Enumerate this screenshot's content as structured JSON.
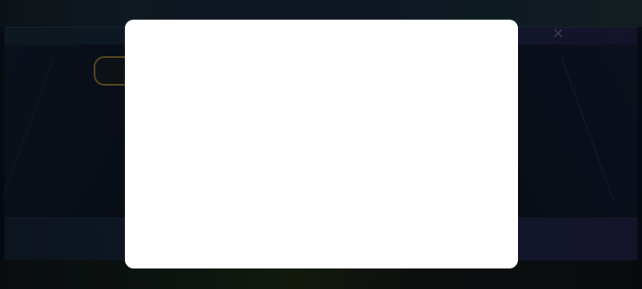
{
  "screen": {
    "state": "modal-open",
    "modal": {
      "content": ""
    },
    "background": {
      "close_icon": "close-icon",
      "accent_color": "#b69a4a"
    }
  }
}
